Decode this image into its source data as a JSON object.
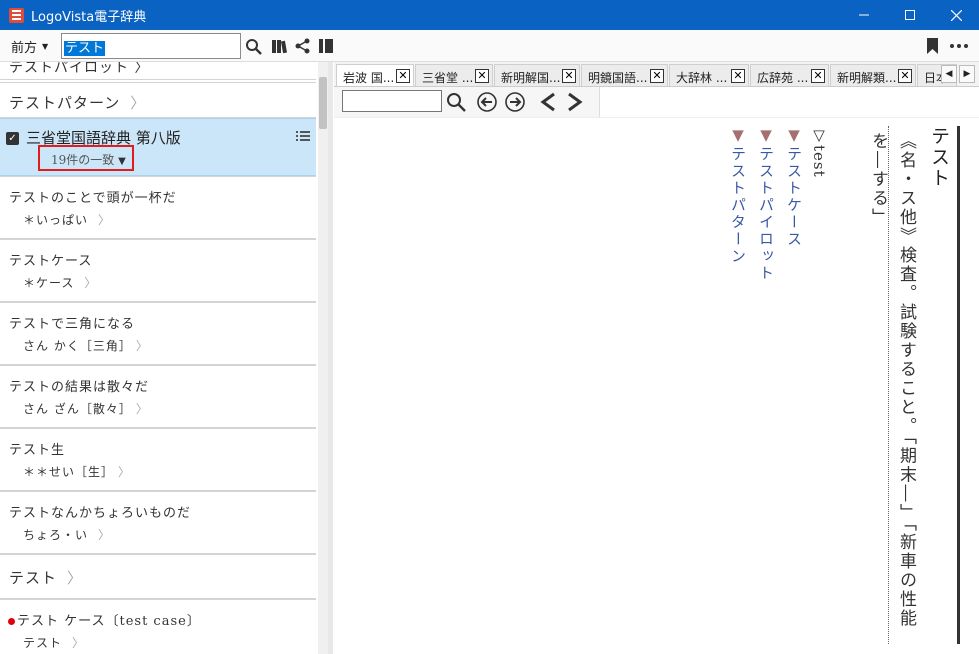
{
  "window": {
    "title": "LogoVista電子辞典",
    "controls": [
      "—",
      "☐",
      "✕"
    ]
  },
  "toolbar": {
    "direction_label": "前方",
    "search_value": "テスト"
  },
  "left_list": {
    "partial_top": "テストパイロット 〉",
    "top_item": "テストパターン",
    "dict": {
      "name": "三省堂国語辞典 第八版",
      "match_count": "19件の一致"
    },
    "items": [
      {
        "title": "テストのことで頭が一杯だ",
        "sub": "＊いっぱい"
      },
      {
        "title": "テストケース",
        "sub": "＊ケース"
      },
      {
        "title": "テストで三角になる",
        "sub": "さん かく［三角］"
      },
      {
        "title": "テストの結果は散々だ",
        "sub": "さん ざん［散々］"
      },
      {
        "title": "テスト生",
        "sub": "＊＊せい［生］"
      },
      {
        "title": "テストなんかちょろいものだ",
        "sub": "ちょろ・い"
      }
    ],
    "plain_item": "テスト",
    "last_item": {
      "title": "テスト ケース〔test case〕",
      "sub": "テスト"
    }
  },
  "tabs": [
    {
      "label": "岩波 国..."
    },
    {
      "label": "三省堂 ..."
    },
    {
      "label": "新明解国..."
    },
    {
      "label": "明鏡国語..."
    },
    {
      "label": "大辞林 ..."
    },
    {
      "label": "広辞苑 ..."
    },
    {
      "label": "新明解類..."
    },
    {
      "label": "日本"
    }
  ],
  "entry": {
    "headword": "テスト",
    "definition_line1": "《名・ス他》検査。試験すること。「期末―」「新車の性能",
    "definition_line2": "を―する」",
    "origin": "▽test",
    "related": [
      "テストケース",
      "テストパイロット",
      "テストパターン"
    ]
  }
}
